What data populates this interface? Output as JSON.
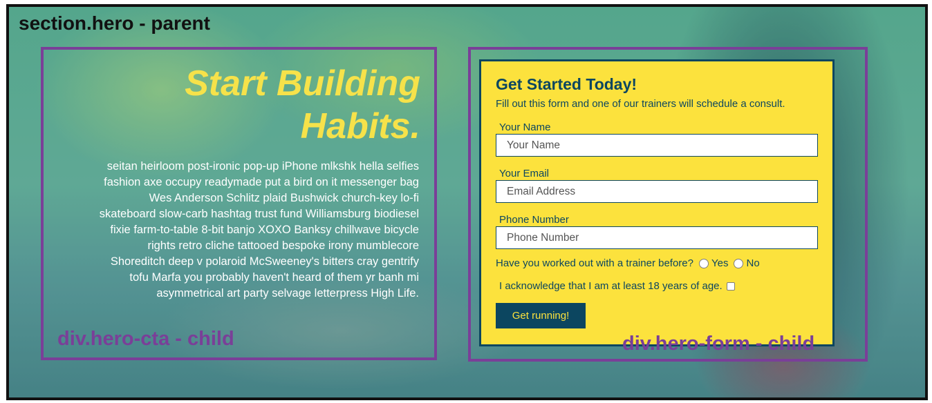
{
  "section_label": "section.hero - parent",
  "cta": {
    "title_line1": "Start Building",
    "title_line2": "Habits.",
    "body": "seitan heirloom post-ironic pop-up iPhone mlkshk hella selfies fashion axe occupy readymade put a bird on it messenger bag Wes Anderson Schlitz plaid Bushwick church-key lo-fi skateboard slow-carb hashtag trust fund Williamsburg biodiesel fixie farm-to-table 8-bit banjo XOXO Banksy chillwave bicycle rights retro cliche tattooed bespoke irony mumblecore Shoreditch deep v polaroid McSweeney's bitters cray gentrify tofu Marfa you probably haven't heard of them yr banh mi asymmetrical art party selvage letterpress High Life.",
    "label": "div.hero-cta - child"
  },
  "form": {
    "title": "Get Started Today!",
    "subtitle": "Fill out this form and one of our trainers will schedule a consult.",
    "name_label": "Your Name",
    "name_placeholder": "Your Name",
    "email_label": "Your Email",
    "email_placeholder": "Email Address",
    "phone_label": "Phone Number",
    "phone_placeholder": "Phone Number",
    "question": "Have you worked out with a trainer before?",
    "option_yes": "Yes",
    "option_no": "No",
    "acknowledge": "I acknowledge that I am at least 18 years of age.",
    "submit_label": "Get running!",
    "label": "div.hero-form - child"
  },
  "colors": {
    "accent_yellow": "#fce23d",
    "navy": "#0c4660",
    "purple_outline": "#7a3f98"
  }
}
